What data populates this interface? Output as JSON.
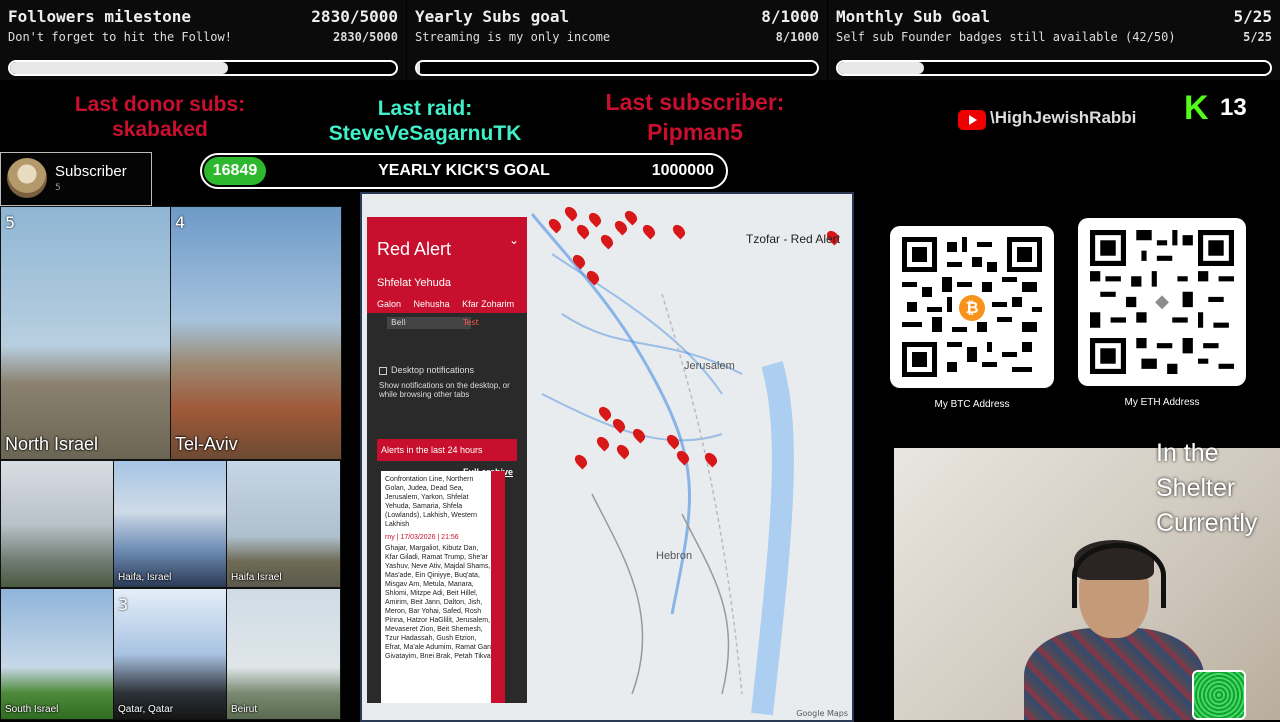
{
  "goals": [
    {
      "title": "Followers milestone",
      "count": "2830/5000",
      "subtitle": "Don't forget to hit the Follow!",
      "progress": 0.566
    },
    {
      "title": "Yearly Subs goal",
      "count": "8/1000",
      "subtitle": "Streaming is my only income",
      "progress": 0.008
    },
    {
      "title": "Monthly Sub Goal",
      "count": "5/25",
      "subtitle": "Self sub Founder badges still available (42/50)",
      "progress": 0.2
    }
  ],
  "events": {
    "donor_label": "Last donor subs:",
    "donor_name": "skabaked",
    "raid_label": "Last raid:",
    "raid_name": "SteveVeSagarnuTK",
    "sub_label": "Last subscriber:",
    "sub_name": "Pipman5"
  },
  "channel": {
    "youtube_name": "\\HighJewishRabbi",
    "kick_count": "13"
  },
  "subscriber_box": {
    "title": "Subscriber",
    "count": "5"
  },
  "kick_goal": {
    "current": "16849",
    "label": "YEARLY KICK'S GOAL",
    "target": "1000000"
  },
  "cameras": [
    {
      "num": "5",
      "label": "North Israel"
    },
    {
      "num": "4",
      "label": "Tel-Aviv"
    },
    {
      "num": "",
      "label": ""
    },
    {
      "num": "",
      "label": "Haifa, Israel"
    },
    {
      "num": "",
      "label": "Haifa Israel"
    },
    {
      "num": "",
      "label": "South Israel"
    },
    {
      "num": "3",
      "label": "Qatar, Qatar"
    },
    {
      "num": "",
      "label": "Beirut"
    }
  ],
  "red_alert": {
    "title": "Red Alert",
    "region": "Shfelat Yehuda",
    "tabs": [
      "Galon",
      "Nehusha",
      "Kfar Zoharim"
    ],
    "bell": "Bell",
    "test": "Test",
    "notif_title": "Desktop notifications",
    "notif_desc": "Show notifications on the desktop, or while browsing other tabs",
    "alerts_label": "Alerts in the last 24 hours",
    "full_archive": "Full archive",
    "list_intro": "Confrontation Line, Northern Golan, Judea, Dead Sea, Jerusalem, Yarkon, Shfelat Yehuda, Samaria, Shfela (Lowlands), Lakhish, Western Lakhish",
    "list_time": "rny | 17/03/2026 | 21:56",
    "list_body": "Ghajar, Margaliot, Kibutz Dan, Kfar Giladi, Ramat Trump, She'ar Yashuv, Neve Ativ, Majdal Shams, Mas'ade, Ein Qiniyye, Buq'ata, Misgav Am, Metula, Manara, Shlomi, Mitzpe Adi, Beit Hillel, Amirim, Beit Jann, Dalton, Jish, Meron, Bar Yohai, Safed, Rosh Pinna, Hatzor HaGlilit, Jerusalem, Mevaseret Zion, Beit Shemesh, Tzur Hadassah, Gush Etzion, Efrat, Ma'ale Adumim, Ramat Gan, Givatayim, Bnei Brak, Petah Tikva",
    "tzofar": "Tzofar - Red Alert",
    "places": [
      "Jerusalem",
      "Hebron"
    ],
    "google": "Google Maps"
  },
  "qr": [
    {
      "caption": "My BTC Address",
      "coin": "₿",
      "color": "#f7931a"
    },
    {
      "caption": "My ETH Address",
      "coin": "◆",
      "color": "#8c8c8c"
    }
  ],
  "overlay": {
    "shelter_line1": "In the",
    "shelter_line2": "Shelter",
    "shelter_line3": "Currently"
  }
}
